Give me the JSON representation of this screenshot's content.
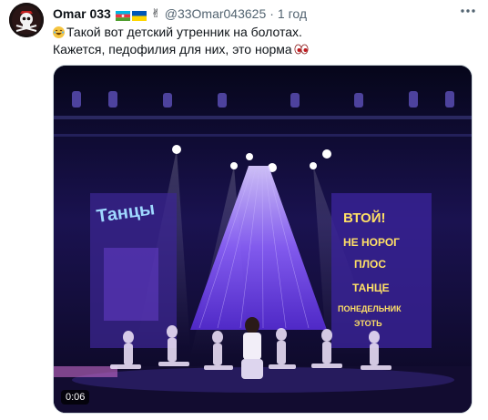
{
  "tweet": {
    "author_name": "Omar 033",
    "handle": "@33Omar043625",
    "separator": "·",
    "time": "1 год",
    "text_line1": "Такой вот детский утренник на болотах.",
    "text_line2": "Кажется, педофилия для них, это норма",
    "icons": [
      "avatar-pirate-icon",
      "azerbaijan-flag-icon",
      "ukraine-flag-icon",
      "victory-hand-icon",
      "laughing-emoji-icon",
      "eyes-emoji-icon",
      "more-icon"
    ]
  },
  "media": {
    "duration": "0:06",
    "stage_sign_left": "Танцы",
    "stage_sign_right": [
      "ВТОЙ!",
      "НЕ НОРОГ",
      "ПЛОС",
      "ТАНЦЕ",
      "ПОНЕДЕЛЬНИК",
      "ЭТОТЬ"
    ],
    "colors": {
      "stage": "#0c0a1e",
      "light": "#b79cff",
      "accent": "#7b3cff"
    }
  }
}
